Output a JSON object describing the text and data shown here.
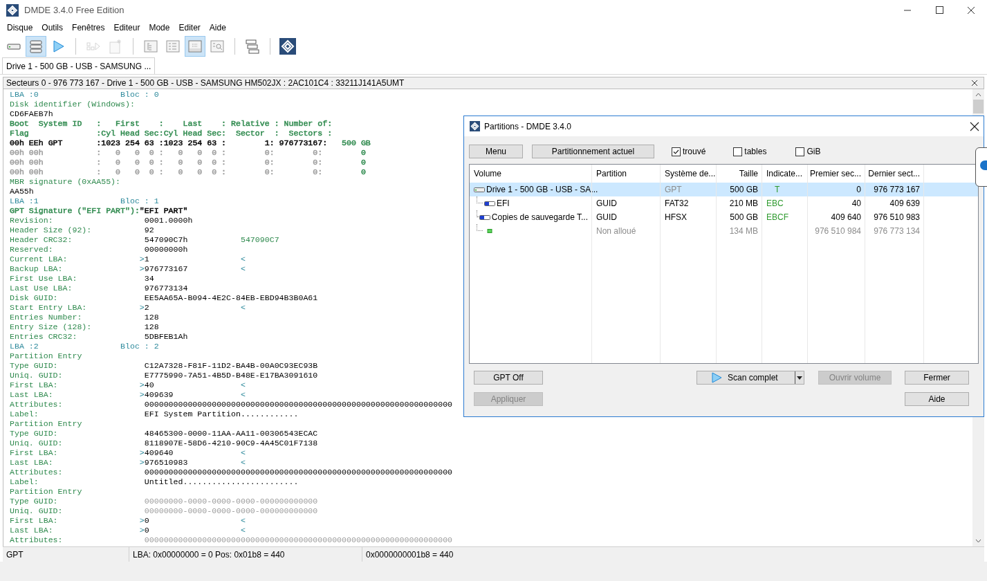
{
  "window": {
    "title": "DMDE 3.4.0 Free Edition"
  },
  "menu": [
    "Disque",
    "Outils",
    "Fenêtres",
    "Editeur",
    "Mode",
    "Editer",
    "Aide"
  ],
  "toolbar": [
    [
      {
        "selected": false,
        "disabled": false
      },
      {
        "selected": true,
        "disabled": false
      },
      {
        "selected": false,
        "disabled": false
      }
    ],
    [
      {
        "selected": false,
        "disabled": true
      },
      {
        "selected": false,
        "disabled": true
      }
    ],
    [
      {
        "selected": false,
        "disabled": false
      },
      {
        "selected": false,
        "disabled": false
      },
      {
        "selected": true,
        "disabled": false
      },
      {
        "selected": false,
        "disabled": false
      }
    ],
    [
      {
        "selected": false,
        "disabled": false
      }
    ],
    [
      {
        "selected": false,
        "disabled": false
      }
    ]
  ],
  "tabs": [
    {
      "label": "Drive 1 - 500 GB - USB - SAMSUNG ...",
      "selected": true
    }
  ],
  "panel_title": "Secteurs 0 - 976 773 167 - Drive 1 - 500 GB - USB - SAMSUNG HM502JX : 2AC101C4 : 33211J141A5UMT",
  "dump": [
    {
      "kind": "header",
      "lba": "LBA :0",
      "bloc": "Bloc : 0"
    },
    {
      "kind": "text",
      "color": "#2f8a4e",
      "text": "Disk identifier (Windows):"
    },
    {
      "kind": "text",
      "color": "#000000",
      "text": "CD6FAEB7h"
    },
    {
      "kind": "row",
      "segments": [
        {
          "color": "#2f8a4e",
          "text": "Boot  System ID   :   First    :    Last    : Relative : Number of:"
        }
      ]
    },
    {
      "kind": "row",
      "segments": [
        {
          "color": "#2f8a4e",
          "text": "Flag              :Cyl Head Sec:Cyl Head Sec:  Sector  :  Sectors :"
        }
      ]
    },
    {
      "kind": "row",
      "segments": [
        {
          "color": "#000000",
          "text": "00h EEh GPT       :1023 254 63 :1023 254 63 :        1: 976773167:"
        },
        {
          "color": "#2f8a4e",
          "text": "   500 GB"
        }
      ]
    },
    {
      "kind": "row",
      "segments": [
        {
          "color": "#9c9c9c",
          "text": "00h 00h           :   0   0  0 :   0   0  0 :        0:        0:"
        },
        {
          "color": "#2f8a4e",
          "text": "        0"
        }
      ]
    },
    {
      "kind": "row",
      "segments": [
        {
          "color": "#9c9c9c",
          "text": "00h 00h           :   0   0  0 :   0   0  0 :        0:        0:"
        },
        {
          "color": "#2f8a4e",
          "text": "        0"
        }
      ]
    },
    {
      "kind": "row",
      "segments": [
        {
          "color": "#9c9c9c",
          "text": "00h 00h           :   0   0  0 :   0   0  0 :        0:        0:"
        },
        {
          "color": "#2f8a4e",
          "text": "        0"
        }
      ]
    },
    {
      "kind": "text",
      "color": "#2f8a4e",
      "text": "MBR signature (0xAA55):"
    },
    {
      "kind": "text",
      "color": "#000000",
      "text": "AA55h"
    },
    {
      "kind": "header",
      "lba": "LBA :1",
      "bloc": "Bloc : 1"
    },
    {
      "kind": "row",
      "segments": [
        {
          "color": "#2f8a4e",
          "text": "GPT Signature (\"EFI PART\"):"
        },
        {
          "color": "#000000",
          "text": "\"EFI PART\""
        }
      ]
    },
    {
      "kind": "field",
      "label": "Revision:",
      "value": "0001.0000h",
      "muted": false
    },
    {
      "kind": "field",
      "label": "Header Size (92):",
      "value": "92",
      "muted": false
    },
    {
      "kind": "field",
      "label": "Header CRC32:",
      "value": "547090C7h",
      "check": "547090C7",
      "muted": false
    },
    {
      "kind": "field",
      "label": "Reserved:",
      "value": "00000000h",
      "muted": false
    },
    {
      "kind": "field",
      "label": "Current LBA:",
      "prefix": ">",
      "value": "1",
      "suffix": "<",
      "muted": false
    },
    {
      "kind": "field",
      "label": "Backup LBA:",
      "prefix": ">",
      "value": "976773167",
      "suffix": "<",
      "muted": false
    },
    {
      "kind": "field",
      "label": "First Use LBA:",
      "value": "34",
      "muted": false
    },
    {
      "kind": "field",
      "label": "Last Use LBA:",
      "value": "976773134",
      "muted": false
    },
    {
      "kind": "field",
      "label": "Disk GUID:",
      "value": "EE5AA65A-B094-4E2C-84EB-EBD94B3B0A61",
      "muted": false
    },
    {
      "kind": "field",
      "label": "Start Entry LBA:",
      "prefix": ">",
      "value": "2",
      "suffix": "<",
      "muted": false
    },
    {
      "kind": "field",
      "label": "Entries Number:",
      "value": "128",
      "muted": false
    },
    {
      "kind": "field",
      "label": "Entry Size (128):",
      "value": "128",
      "muted": false
    },
    {
      "kind": "field",
      "label": "Entries CRC32:",
      "value": "5DBFEB1Ah",
      "muted": false
    },
    {
      "kind": "header",
      "lba": "LBA :2",
      "bloc": "Bloc : 2"
    },
    {
      "kind": "text",
      "color": "#2f8a4e",
      "text": "Partition Entry"
    },
    {
      "kind": "field",
      "label": "Type GUID:",
      "value": "C12A7328-F81F-11D2-BA4B-00A0C93EC93B",
      "muted": false
    },
    {
      "kind": "field",
      "label": "Uniq. GUID:",
      "value": "E7775990-7A51-4B5D-B48E-E17BA3091610",
      "muted": false
    },
    {
      "kind": "field",
      "label": "First LBA:",
      "prefix": ">",
      "value": "40",
      "suffix": "<",
      "muted": false
    },
    {
      "kind": "field",
      "label": "Last LBA:",
      "prefix": ">",
      "value": "409639",
      "suffix": "<",
      "muted": false
    },
    {
      "kind": "field",
      "label": "Attributes:",
      "value": "0000000000000000000000000000000000000000000000000000000000000000",
      "muted": false
    },
    {
      "kind": "field",
      "label": "Label:",
      "value": "EFI System Partition............",
      "muted": false
    },
    {
      "kind": "text",
      "color": "#2f8a4e",
      "text": "Partition Entry"
    },
    {
      "kind": "field",
      "label": "Type GUID:",
      "value": "48465300-0000-11AA-AA11-00306543ECAC",
      "muted": false
    },
    {
      "kind": "field",
      "label": "Uniq. GUID:",
      "value": "8118907E-58D6-4210-90C9-4A45C01F7138",
      "muted": false
    },
    {
      "kind": "field",
      "label": "First LBA:",
      "prefix": ">",
      "value": "409640",
      "suffix": "<",
      "muted": false
    },
    {
      "kind": "field",
      "label": "Last LBA:",
      "prefix": ">",
      "value": "976510983",
      "suffix": "<",
      "muted": false
    },
    {
      "kind": "field",
      "label": "Attributes:",
      "value": "0000000000000000000000000000000000000000000000000000000000000000",
      "muted": false
    },
    {
      "kind": "field",
      "label": "Label:",
      "value": "Untitled........................",
      "muted": false
    },
    {
      "kind": "text",
      "color": "#2f8a4e",
      "text": "Partition Entry"
    },
    {
      "kind": "field",
      "label": "Type GUID:",
      "value": "00000000-0000-0000-0000-000000000000",
      "muted": true
    },
    {
      "kind": "field",
      "label": "Uniq. GUID:",
      "value": "00000000-0000-0000-0000-000000000000",
      "muted": true
    },
    {
      "kind": "field",
      "label": "First LBA:",
      "prefix": ">",
      "value": "0",
      "suffix": "<",
      "muted": false
    },
    {
      "kind": "field",
      "label": "Last LBA:",
      "prefix": ">",
      "value": "0",
      "suffix": "<",
      "muted": false
    },
    {
      "kind": "field",
      "label": "Attributes:",
      "value": "0000000000000000000000000000000000000000000000000000000000000000",
      "muted": true
    }
  ],
  "status_bar": [
    "GPT",
    "LBA: 0x00000000 = 0  Pos: 0x01b8 = 440",
    "0x0000000001b8 = 440"
  ],
  "dialog": {
    "title": "Partitions - DMDE 3.4.0",
    "buttons_top": [
      {
        "label": "Menu",
        "disabled": false
      },
      {
        "label": "Partitionnement actuel",
        "disabled": false
      }
    ],
    "checkboxes": [
      {
        "label": "trouvé",
        "checked": true
      },
      {
        "label": "tables",
        "checked": false
      },
      {
        "label": "GiB",
        "checked": false
      }
    ],
    "columns": [
      "Volume",
      "Partition",
      "Système de...",
      "Taille",
      "Indicate...",
      "Premier sec...",
      "Dernier sect..."
    ],
    "rows": [
      {
        "kind": "drive",
        "selected": true,
        "muted": false,
        "cells": [
          "Drive 1 - 500 GB - USB - SA...",
          "",
          "GPT",
          "500 GB",
          "T",
          "0",
          "976 773 167"
        ],
        "children": [
          {
            "kind": "partition",
            "selected": false,
            "muted": false,
            "cells": [
              "EFI",
              "GUID",
              "FAT32",
              "210 MB",
              "EBC",
              "40",
              "409 639"
            ]
          },
          {
            "kind": "partition",
            "selected": false,
            "muted": false,
            "cells": [
              "Copies de sauvegarde T...",
              "GUID",
              "HFSX",
              "500 GB",
              "EBCF",
              "409 640",
              "976 510 983"
            ]
          },
          {
            "kind": "free",
            "selected": false,
            "muted": true,
            "cells": [
              "",
              "Non alloué",
              "",
              "134 MB",
              "",
              "976 510 984",
              "976 773 134"
            ]
          }
        ]
      }
    ],
    "buttons_bottom": [
      {
        "label": "GPT Off",
        "disabled": false
      },
      {
        "label": "Appliquer",
        "disabled": true
      },
      {
        "label": "Scan complet",
        "disabled": false
      },
      {
        "label": "Ouvrir volume",
        "disabled": true
      },
      {
        "label": "Fermer",
        "disabled": false
      },
      {
        "label": "Aide",
        "disabled": false
      }
    ]
  }
}
